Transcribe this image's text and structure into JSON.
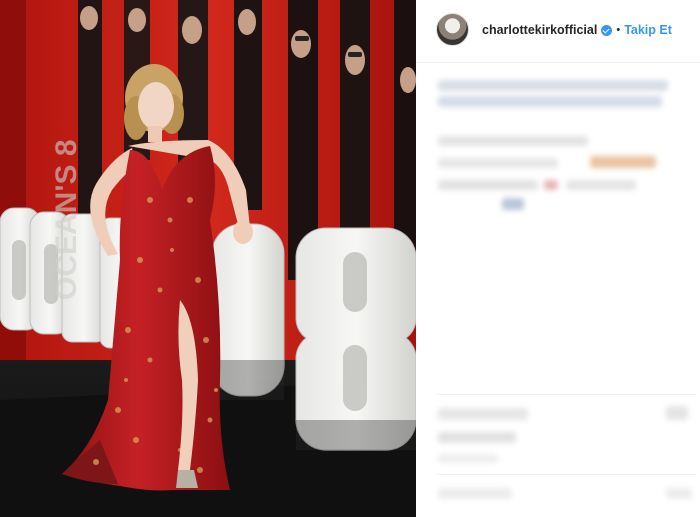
{
  "post": {
    "author": "charlottekirkofficial",
    "verified": true,
    "separator": "•",
    "follow_label": "Takip Et"
  },
  "photo": {
    "sign_text": "OCEAN'S 8"
  },
  "icons": {
    "verified": "verified-badge-icon"
  },
  "colors": {
    "link": "#3897f0",
    "text": "#262626",
    "backdrop": "#c0221a",
    "dress": "#b51a1e"
  }
}
